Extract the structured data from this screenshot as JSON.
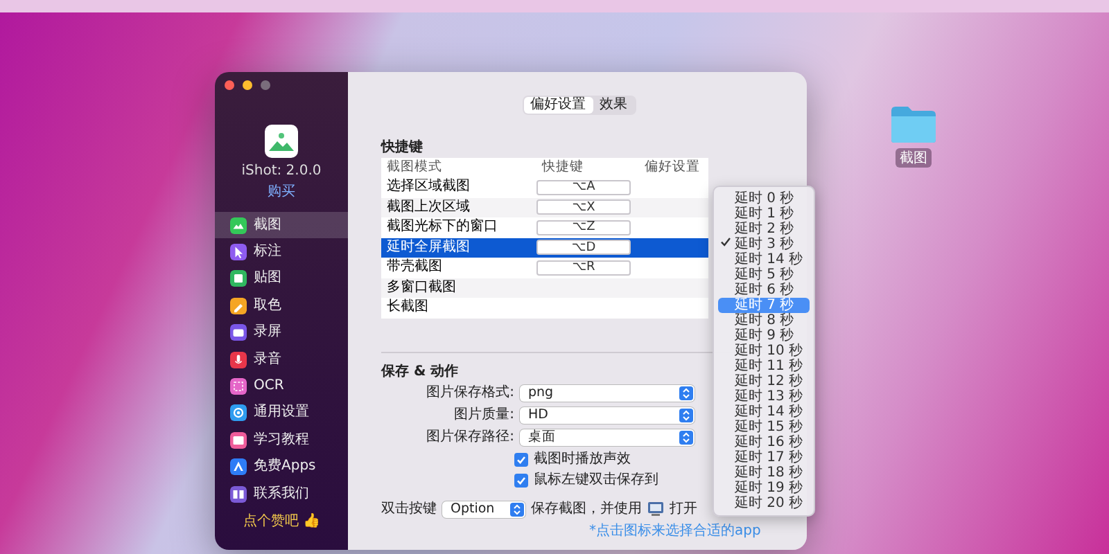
{
  "desktop_icon": {
    "label": "截图"
  },
  "sidebar": {
    "app_name": "iShot: 2.0.0",
    "buy_link": "购买",
    "items": [
      {
        "label": "截图",
        "selected": true,
        "color": "#34c759"
      },
      {
        "label": "标注",
        "selected": false,
        "color": "#8e5cf0"
      },
      {
        "label": "贴图",
        "selected": false,
        "color": "#30b860"
      },
      {
        "label": "取色",
        "selected": false,
        "color": "#f5a524"
      },
      {
        "label": "录屏",
        "selected": false,
        "color": "#7a56e8"
      },
      {
        "label": "录音",
        "selected": false,
        "color": "#e8364a"
      },
      {
        "label": "OCR",
        "selected": false,
        "color": "#e565c8"
      },
      {
        "label": "通用设置",
        "selected": false,
        "color": "#2f9cf0"
      },
      {
        "label": "学习教程",
        "selected": false,
        "color": "#ee5c9a"
      },
      {
        "label": "免费Apps",
        "selected": false,
        "color": "#2e7cf6"
      },
      {
        "label": "联系我们",
        "selected": false,
        "color": "#7b5ad6"
      }
    ],
    "footer": "点个赞吧 👍"
  },
  "tabs": [
    {
      "label": "偏好设置",
      "selected": true
    },
    {
      "label": "效果",
      "selected": false
    }
  ],
  "shortcuts": {
    "title": "快捷键",
    "columns": [
      "截图模式",
      "快捷键",
      "偏好设置"
    ],
    "rows": [
      {
        "mode": "选择区域截图",
        "shortcut": "⌥A",
        "selected": false
      },
      {
        "mode": "截图上次区域",
        "shortcut": "⌥X",
        "selected": false
      },
      {
        "mode": "截图光标下的窗口",
        "shortcut": "⌥Z",
        "selected": false
      },
      {
        "mode": "延时全屏截图",
        "shortcut": "⌥D",
        "selected": true
      },
      {
        "mode": "带壳截图",
        "shortcut": "⌥R",
        "selected": false
      },
      {
        "mode": "多窗口截图",
        "selected": false
      },
      {
        "mode": "长截图",
        "selected": false
      }
    ]
  },
  "save": {
    "title": "保存 & 动作",
    "fields": [
      {
        "label": "图片保存格式:",
        "value": "png"
      },
      {
        "label": "图片质量:",
        "value": "HD"
      },
      {
        "label": "图片保存路径:",
        "value": "桌面"
      }
    ],
    "checkboxes": [
      {
        "label": "截图时播放声效",
        "checked": true
      },
      {
        "label": "鼠标左键双击保存到",
        "checked": true
      }
    ],
    "double_click": {
      "label": "双击按键",
      "value": "Option",
      "text": "保存截图，并使用",
      "text_after": "打开",
      "hint": "*点击图标来选择合适的app"
    }
  },
  "delay_menu": {
    "items": [
      {
        "label": "延时 0 秒",
        "checked": false,
        "selected": false
      },
      {
        "label": "延时 1 秒",
        "checked": false,
        "selected": false
      },
      {
        "label": "延时 2 秒",
        "checked": false,
        "selected": false
      },
      {
        "label": "延时 3 秒",
        "checked": true,
        "selected": false
      },
      {
        "label": "延时 14 秒",
        "checked": false,
        "selected": false
      },
      {
        "label": "延时 5 秒",
        "checked": false,
        "selected": false
      },
      {
        "label": "延时 6 秒",
        "checked": false,
        "selected": false
      },
      {
        "label": "延时 7 秒",
        "checked": false,
        "selected": true
      },
      {
        "label": "延时 8 秒",
        "checked": false,
        "selected": false
      },
      {
        "label": "延时 9 秒",
        "checked": false,
        "selected": false
      },
      {
        "label": "延时 10 秒",
        "checked": false,
        "selected": false
      },
      {
        "label": "延时 11 秒",
        "checked": false,
        "selected": false
      },
      {
        "label": "延时 12 秒",
        "checked": false,
        "selected": false
      },
      {
        "label": "延时 13 秒",
        "checked": false,
        "selected": false
      },
      {
        "label": "延时 14 秒",
        "checked": false,
        "selected": false
      },
      {
        "label": "延时 15 秒",
        "checked": false,
        "selected": false
      },
      {
        "label": "延时 16 秒",
        "checked": false,
        "selected": false
      },
      {
        "label": "延时 17 秒",
        "checked": false,
        "selected": false
      },
      {
        "label": "延时 18 秒",
        "checked": false,
        "selected": false
      },
      {
        "label": "延时 19 秒",
        "checked": false,
        "selected": false
      },
      {
        "label": "延时 20 秒",
        "checked": false,
        "selected": false
      }
    ]
  }
}
